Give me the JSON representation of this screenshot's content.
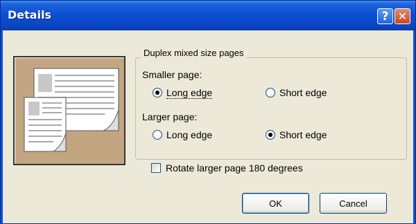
{
  "window": {
    "title": "Details"
  },
  "titlebar": {
    "help_label": "?",
    "close_label": "✕"
  },
  "duplex": {
    "legend": "Duplex mixed size pages",
    "smaller": {
      "label": "Smaller page:",
      "options": [
        "Long edge",
        "Short edge"
      ],
      "selected": "Long edge"
    },
    "larger": {
      "label": "Larger page:",
      "options": [
        "Long edge",
        "Short edge"
      ],
      "selected": "Short edge"
    }
  },
  "rotate": {
    "label": "Rotate larger page 180 degrees",
    "checked": false
  },
  "buttons": {
    "ok": "OK",
    "cancel": "Cancel"
  },
  "colors": {
    "titlebar": "#0b4fd3",
    "dialog_bg": "#ece9d8",
    "preview_bg": "#c4a582"
  }
}
